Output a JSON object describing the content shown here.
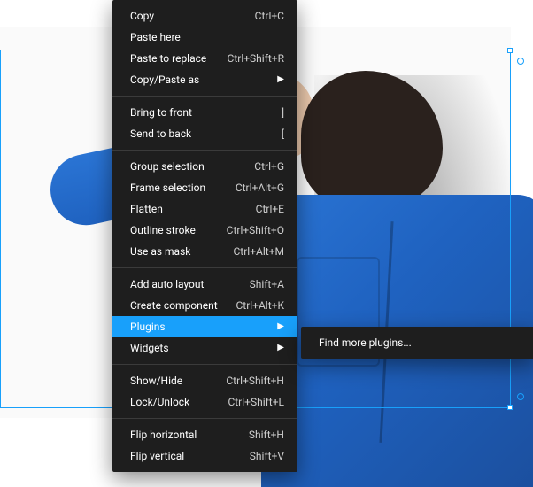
{
  "menu": {
    "groups": [
      [
        {
          "id": "copy",
          "label": "Copy",
          "shortcut": "Ctrl+C",
          "submenu": false,
          "highlight": false
        },
        {
          "id": "paste-here",
          "label": "Paste here",
          "shortcut": "",
          "submenu": false,
          "highlight": false
        },
        {
          "id": "paste-replace",
          "label": "Paste to replace",
          "shortcut": "Ctrl+Shift+R",
          "submenu": false,
          "highlight": false
        },
        {
          "id": "copy-paste-as",
          "label": "Copy/Paste as",
          "shortcut": "",
          "submenu": true,
          "highlight": false
        }
      ],
      [
        {
          "id": "bring-front",
          "label": "Bring to front",
          "shortcut": "]",
          "submenu": false,
          "highlight": false
        },
        {
          "id": "send-back",
          "label": "Send to back",
          "shortcut": "[",
          "submenu": false,
          "highlight": false
        }
      ],
      [
        {
          "id": "group-sel",
          "label": "Group selection",
          "shortcut": "Ctrl+G",
          "submenu": false,
          "highlight": false
        },
        {
          "id": "frame-sel",
          "label": "Frame selection",
          "shortcut": "Ctrl+Alt+G",
          "submenu": false,
          "highlight": false
        },
        {
          "id": "flatten",
          "label": "Flatten",
          "shortcut": "Ctrl+E",
          "submenu": false,
          "highlight": false
        },
        {
          "id": "outline-stroke",
          "label": "Outline stroke",
          "shortcut": "Ctrl+Shift+O",
          "submenu": false,
          "highlight": false
        },
        {
          "id": "use-mask",
          "label": "Use as mask",
          "shortcut": "Ctrl+Alt+M",
          "submenu": false,
          "highlight": false
        }
      ],
      [
        {
          "id": "auto-layout",
          "label": "Add auto layout",
          "shortcut": "Shift+A",
          "submenu": false,
          "highlight": false
        },
        {
          "id": "create-comp",
          "label": "Create component",
          "shortcut": "Ctrl+Alt+K",
          "submenu": false,
          "highlight": false
        },
        {
          "id": "plugins",
          "label": "Plugins",
          "shortcut": "",
          "submenu": true,
          "highlight": true
        },
        {
          "id": "widgets",
          "label": "Widgets",
          "shortcut": "",
          "submenu": true,
          "highlight": false
        }
      ],
      [
        {
          "id": "show-hide",
          "label": "Show/Hide",
          "shortcut": "Ctrl+Shift+H",
          "submenu": false,
          "highlight": false
        },
        {
          "id": "lock-unlock",
          "label": "Lock/Unlock",
          "shortcut": "Ctrl+Shift+L",
          "submenu": false,
          "highlight": false
        }
      ],
      [
        {
          "id": "flip-h",
          "label": "Flip horizontal",
          "shortcut": "Shift+H",
          "submenu": false,
          "highlight": false
        },
        {
          "id": "flip-v",
          "label": "Flip vertical",
          "shortcut": "Shift+V",
          "submenu": false,
          "highlight": false
        }
      ]
    ]
  },
  "submenu": {
    "items": [
      {
        "id": "find-more",
        "label": "Find more plugins...",
        "shortcut": "",
        "submenu": false,
        "highlight": false
      }
    ]
  },
  "colors": {
    "accent": "#18a0fb",
    "menu_bg": "#1e1e1e"
  }
}
